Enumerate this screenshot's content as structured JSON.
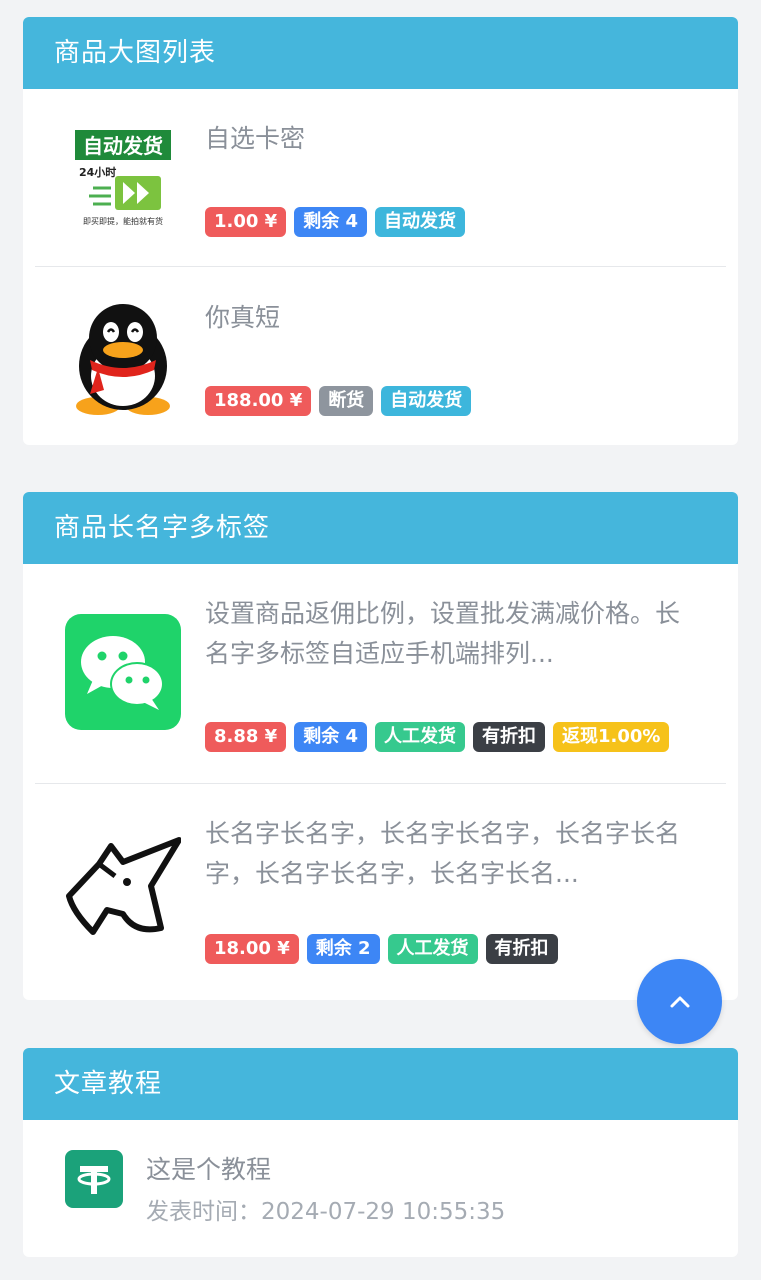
{
  "colors": {
    "header": "#45b6dc",
    "price": "#ef5b5b",
    "stock": "#3d86f5",
    "auto": "#3db6dc",
    "manual": "#36c98e",
    "soldout": "#8e959e",
    "discount": "#3b3f45",
    "cashback": "#f6c21a",
    "backtop": "#3d86f5"
  },
  "sections": [
    {
      "title": "商品大图列表",
      "items": [
        {
          "image": "auto-delivery-badge",
          "name": "自选卡密",
          "tags": [
            {
              "text": "1.00 ¥",
              "kind": "price"
            },
            {
              "text": "剩余 4",
              "kind": "stock"
            },
            {
              "text": "自动发货",
              "kind": "auto"
            }
          ]
        },
        {
          "image": "penguin-icon",
          "name": "你真短",
          "tags": [
            {
              "text": "188.00 ¥",
              "kind": "price"
            },
            {
              "text": "断货",
              "kind": "soldout"
            },
            {
              "text": "自动发货",
              "kind": "auto"
            }
          ]
        }
      ]
    },
    {
      "title": "商品长名字多标签",
      "items": [
        {
          "image": "wechat-icon",
          "name": "设置商品返佣比例，设置批发满减价格。长名字多标签自适应手机端排列...",
          "tags": [
            {
              "text": "8.88 ¥",
              "kind": "price"
            },
            {
              "text": "剩余 4",
              "kind": "stock"
            },
            {
              "text": "人工发货",
              "kind": "manual"
            },
            {
              "text": "有折扣",
              "kind": "discount"
            },
            {
              "text": "返现1.00%",
              "kind": "cashback"
            }
          ]
        },
        {
          "image": "unicorn-icon",
          "name": "长名字长名字，长名字长名字，长名字长名字，长名字长名字，长名字长名...",
          "tags": [
            {
              "text": "18.00 ¥",
              "kind": "price"
            },
            {
              "text": "剩余 2",
              "kind": "stock"
            },
            {
              "text": "人工发货",
              "kind": "manual"
            },
            {
              "text": "有折扣",
              "kind": "discount"
            }
          ]
        }
      ]
    }
  ],
  "articles": {
    "title": "文章教程",
    "items": [
      {
        "icon": "tether-icon",
        "title": "这是个教程",
        "time": "发表时间：2024-07-29 10:55:35"
      }
    ]
  },
  "badge_text": {
    "auto_delivery": "自动发货",
    "hours": "24小时",
    "slogan": "即买即提，能拍就有货"
  },
  "back_to_top": {
    "icon": "chevron-up-icon"
  }
}
